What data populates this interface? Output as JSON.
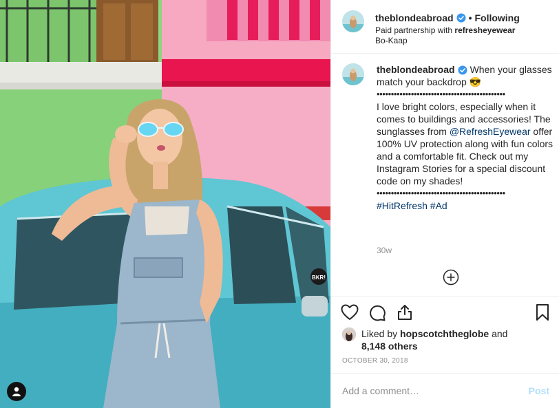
{
  "post": {
    "username": "theblondeabroad",
    "follow_status": "Following",
    "separator": "•",
    "partnership_prefix": "Paid partnership with",
    "partner": "refresheyewear",
    "location": "Bo-Kaap"
  },
  "caption": {
    "username": "theblondeabroad",
    "intro": "When your glasses match your backdrop 😎",
    "dots1": "•••••••••••••••••••••••••••••••••••••••••••••",
    "body_before_mention": "I love bright colors, especially when it comes to buildings and accessories! The sunglasses from",
    "mention": "@RefreshEyewear",
    "body_after_mention": "offer 100% UV protection along with fun colors and a comfortable fit. Check out my Instagram Stories for a special discount code on my shades!",
    "dots2": "•••••••••••••••••••••••••••••••••••••••••••••",
    "hashtags": "#HitRefresh #Ad",
    "time_ago": "30w"
  },
  "likes": {
    "prefix": "Liked by",
    "user": "hopscotchtheglobe",
    "and": "and",
    "others": "8,148 others"
  },
  "date": "OCTOBER 30, 2018",
  "comment_box": {
    "placeholder": "Add a comment…",
    "post_label": "Post"
  },
  "colors": {
    "verified_blue": "#3897f0",
    "link_blue": "#003569",
    "post_button_disabled": "#b2dffc",
    "muted_text": "#8e8e8e"
  },
  "icons": {
    "like": "heart-icon",
    "comment": "comment-icon",
    "share": "share-icon",
    "save": "bookmark-icon",
    "load_more": "plus-circle-icon",
    "user_tags": "person-icon",
    "verified": "verified-badge-icon"
  }
}
